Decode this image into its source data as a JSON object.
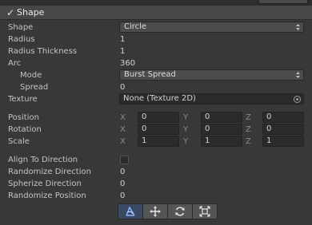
{
  "header": {
    "title": "Shape"
  },
  "shape": {
    "label": "Shape",
    "value": "Circle"
  },
  "radius": {
    "label": "Radius",
    "value": "1"
  },
  "radius_thickness": {
    "label": "Radius Thickness",
    "value": "1"
  },
  "arc": {
    "label": "Arc",
    "value": "360"
  },
  "mode": {
    "label": "Mode",
    "value": "Burst Spread"
  },
  "spread": {
    "label": "Spread",
    "value": "0"
  },
  "texture": {
    "label": "Texture",
    "value": "None (Texture 2D)"
  },
  "position": {
    "label": "Position",
    "x": "0",
    "y": "0",
    "z": "0"
  },
  "rotation": {
    "label": "Rotation",
    "x": "0",
    "y": "0",
    "z": "0"
  },
  "scale": {
    "label": "Scale",
    "x": "1",
    "y": "1",
    "z": "1"
  },
  "axis_labels": {
    "x": "X",
    "y": "Y",
    "z": "Z"
  },
  "align_to_direction": {
    "label": "Align To Direction",
    "checked": false
  },
  "randomize_direction": {
    "label": "Randomize Direction",
    "value": "0"
  },
  "spherize_direction": {
    "label": "Spherize Direction",
    "value": "0"
  },
  "randomize_position": {
    "label": "Randomize Position",
    "value": "0"
  },
  "toolbar": {
    "icons": [
      "edit-shape-icon",
      "move-icon",
      "rotate-icon",
      "scale-icon"
    ]
  }
}
